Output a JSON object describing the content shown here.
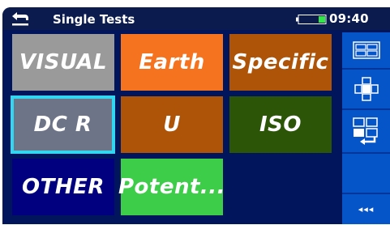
{
  "header": {
    "title": "Single Tests",
    "time": "09:40",
    "battery_level": 0.25
  },
  "tiles": [
    {
      "label": "VISUAL",
      "color": "#9a9a9a"
    },
    {
      "label": "Earth",
      "color": "#f5731f"
    },
    {
      "label": "Specific",
      "color": "#ad5409"
    },
    {
      "label": "DC R",
      "color": "#6e7488",
      "selected": true
    },
    {
      "label": "U",
      "color": "#ad5409"
    },
    {
      "label": "ISO",
      "color": "#2c5508"
    },
    {
      "label": "OTHER",
      "color": "#01007e"
    },
    {
      "label": "Potent...",
      "color": "#3dcd48"
    }
  ],
  "side_panel": {
    "buttons": [
      "grid-view-icon",
      "cross-select-icon",
      "swap-view-icon",
      "more-icon"
    ],
    "more_label": "◂◂◂"
  },
  "colors": {
    "background": "#01155d",
    "side_panel": "#0555c8",
    "selection": "#33d6f0"
  }
}
